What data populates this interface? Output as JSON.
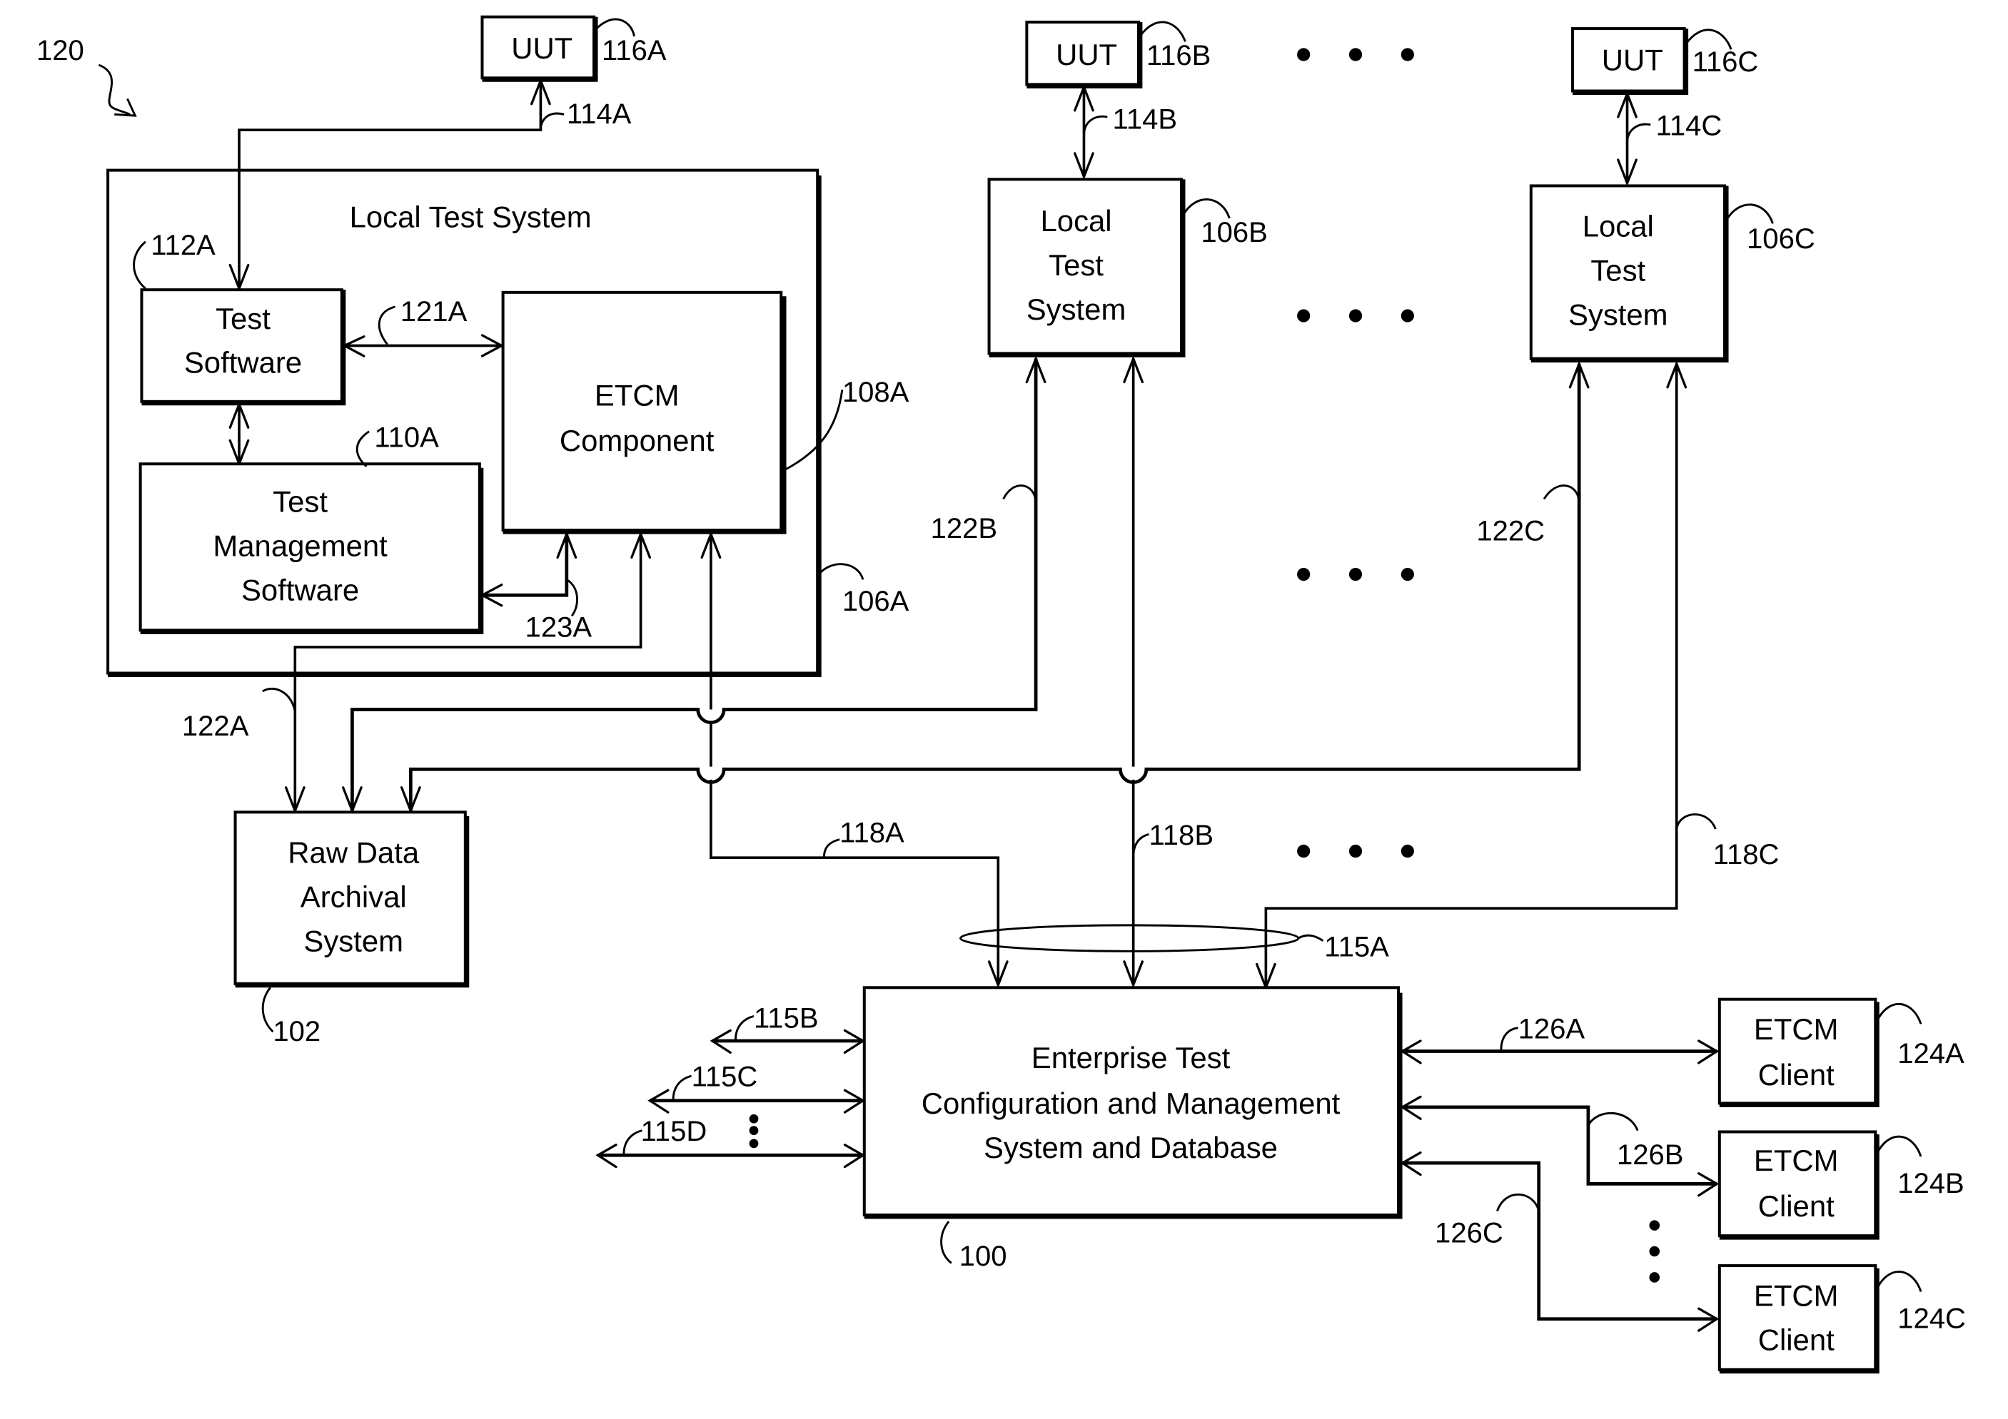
{
  "figure": {
    "reference": "120",
    "nodes": {
      "uut_a": {
        "label": "UUT",
        "ref": "116A"
      },
      "uut_b": {
        "label": "UUT",
        "ref": "116B"
      },
      "uut_c": {
        "label": "UUT",
        "ref": "116C"
      },
      "local_test_system_a": {
        "title": "Local Test System",
        "ref": "106A"
      },
      "test_software": {
        "lines": [
          "Test",
          "Software"
        ],
        "ref": "112A"
      },
      "test_management_software": {
        "lines": [
          "Test",
          "Management",
          "Software"
        ],
        "ref": "110A"
      },
      "etcm_component": {
        "lines": [
          "ETCM",
          "Component"
        ],
        "ref": "108A"
      },
      "local_test_system_b": {
        "lines": [
          "Local",
          "Test",
          "System"
        ],
        "ref": "106B"
      },
      "local_test_system_c": {
        "lines": [
          "Local",
          "Test",
          "System"
        ],
        "ref": "106C"
      },
      "raw_data_archival": {
        "lines": [
          "Raw Data",
          "Archival",
          "System"
        ],
        "ref": "102"
      },
      "enterprise_system": {
        "lines": [
          "Enterprise Test",
          "Configuration and Management",
          "System and Database"
        ],
        "ref": "100"
      },
      "etcm_client_a": {
        "lines": [
          "ETCM",
          "Client"
        ],
        "ref": "124A"
      },
      "etcm_client_b": {
        "lines": [
          "ETCM",
          "Client"
        ],
        "ref": "124B"
      },
      "etcm_client_c": {
        "lines": [
          "ETCM",
          "Client"
        ],
        "ref": "124C"
      }
    },
    "links": {
      "l114a": "114A",
      "l114b": "114B",
      "l114c": "114C",
      "l121a": "121A",
      "l123a": "123A",
      "l122a": "122A",
      "l122b": "122B",
      "l122c": "122C",
      "l118a": "118A",
      "l118b": "118B",
      "l118c": "118C",
      "l115a": "115A",
      "l115b": "115B",
      "l115c": "115C",
      "l115d": "115D",
      "l126a": "126A",
      "l126b": "126B",
      "l126c": "126C"
    },
    "ellipsis": "•  •  •"
  }
}
